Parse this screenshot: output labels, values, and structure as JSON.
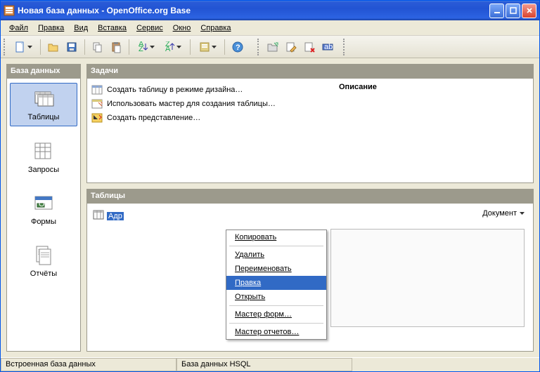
{
  "titlebar": {
    "title": "Новая база данных - OpenOffice.org Base"
  },
  "menus": [
    "Файл",
    "Правка",
    "Вид",
    "Вставка",
    "Сервис",
    "Окно",
    "Справка"
  ],
  "sidebar": {
    "header": "База данных",
    "items": [
      {
        "label": "Таблицы"
      },
      {
        "label": "Запросы"
      },
      {
        "label": "Формы"
      },
      {
        "label": "Отчёты"
      }
    ]
  },
  "tasks": {
    "header": "Задачи",
    "items": [
      {
        "label": "Создать таблицу в режиме дизайна…"
      },
      {
        "label": "Использовать мастер для создания таблицы…"
      },
      {
        "label": "Создать представление…"
      }
    ],
    "description_title": "Описание"
  },
  "tables": {
    "header": "Таблицы",
    "doc_label": "Документ",
    "entry": "Адр"
  },
  "context_menu": {
    "items": [
      {
        "label": "Копировать",
        "u": "К"
      },
      {
        "label": "Удалить",
        "u": "У"
      },
      {
        "label": "Переименовать",
        "u": "П"
      },
      {
        "label": "Правка",
        "u": "П",
        "highlighted": true
      },
      {
        "label": "Открыть",
        "u": "О"
      },
      {
        "label": "Мастер форм…",
        "u": "М"
      },
      {
        "label": "Мастер отчетов…",
        "u": "М"
      }
    ]
  },
  "statusbar": {
    "cell1": "Встроенная база данных",
    "cell2": "База данных HSQL"
  }
}
